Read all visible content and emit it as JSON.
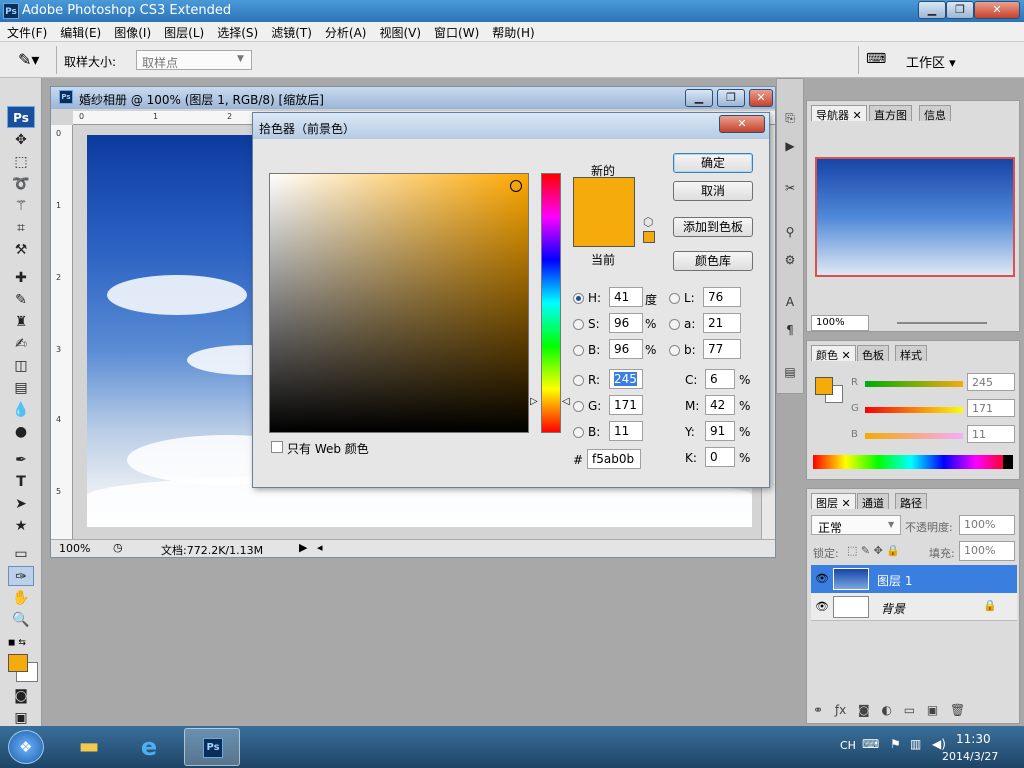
{
  "app": {
    "title": "Adobe Photoshop CS3 Extended",
    "icon_label": "Ps"
  },
  "menu": [
    "文件(F)",
    "编辑(E)",
    "图像(I)",
    "图层(L)",
    "选择(S)",
    "滤镜(T)",
    "分析(A)",
    "视图(V)",
    "窗口(W)",
    "帮助(H)"
  ],
  "options": {
    "sample_size_label": "取样大小:",
    "sample_size_value": "取样点",
    "workspace_label": "工作区"
  },
  "document": {
    "title": "婚纱相册 @ 100% (图层 1, RGB/8) [缩放后]",
    "ruler_top": [
      "0",
      "1",
      "2"
    ],
    "ruler_left": [
      "0",
      "1",
      "2",
      "3",
      "4",
      "5"
    ],
    "zoom": "100%",
    "doc_info": "文档:772.2K/1.13M"
  },
  "picker": {
    "title": "拾色器（前景色）",
    "new_label": "新的",
    "current_label": "当前",
    "new_color": "#f5ab0b",
    "current_color": "#f5ab0b",
    "ok": "确定",
    "cancel": "取消",
    "add_swatch": "添加到色板",
    "color_libraries": "颜色库",
    "web_only": "只有 Web 颜色",
    "hsb": [
      {
        "k": "H:",
        "v": "41",
        "u": "度"
      },
      {
        "k": "S:",
        "v": "96",
        "u": "%"
      },
      {
        "k": "B:",
        "v": "96",
        "u": "%"
      }
    ],
    "lab": [
      {
        "k": "L:",
        "v": "76"
      },
      {
        "k": "a:",
        "v": "21"
      },
      {
        "k": "b:",
        "v": "77"
      }
    ],
    "rgb": [
      {
        "k": "R:",
        "v": "245"
      },
      {
        "k": "G:",
        "v": "171"
      },
      {
        "k": "B:",
        "v": "11"
      }
    ],
    "cmyk": [
      {
        "k": "C:",
        "v": "6",
        "u": "%"
      },
      {
        "k": "M:",
        "v": "42",
        "u": "%"
      },
      {
        "k": "Y:",
        "v": "91",
        "u": "%"
      },
      {
        "k": "K:",
        "v": "0",
        "u": "%"
      }
    ],
    "hex_label": "#",
    "hex": "f5ab0b"
  },
  "navigator": {
    "tabs": [
      "导航器",
      "直方图",
      "信息"
    ],
    "zoom": "100%"
  },
  "color_panel": {
    "tabs": [
      "颜色",
      "色板",
      "样式"
    ],
    "channels": [
      {
        "k": "R",
        "v": "245"
      },
      {
        "k": "G",
        "v": "171"
      },
      {
        "k": "B",
        "v": "11"
      }
    ],
    "foreground": "#f5ab0b"
  },
  "layers": {
    "tabs": [
      "图层",
      "通道",
      "路径"
    ],
    "blend_mode": "正常",
    "opacity_label": "不透明度:",
    "opacity": "100%",
    "lock_label": "锁定:",
    "fill_label": "填充:",
    "fill": "100%",
    "items": [
      {
        "name": "图层 1",
        "selected": true
      },
      {
        "name": "背景",
        "selected": false
      }
    ]
  },
  "taskbar": {
    "lang": "CH",
    "time": "11:30",
    "date": "2014/3/27",
    "ps_label": "Ps"
  }
}
